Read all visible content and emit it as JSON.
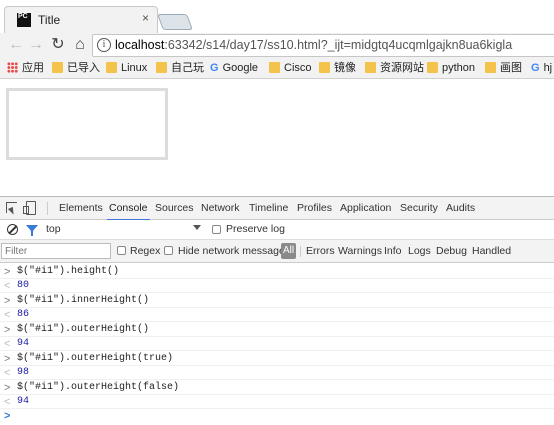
{
  "tab": {
    "favicon_text": "PC",
    "title": "Title",
    "close": "×"
  },
  "toolbar": {
    "back": "←",
    "forward": "→",
    "reload": "↻",
    "home": "⌂",
    "info": "i",
    "url_host": "localhost",
    "url_rest": ":63342/s14/day17/ss10.html?_ijt=midgtq4ucqmlgajkn8ua6kigla"
  },
  "bookmarks": [
    {
      "icon": "apps-icon",
      "label": "应用"
    },
    {
      "icon": "folder-icon",
      "label": "已导入"
    },
    {
      "icon": "folder-icon",
      "label": "Linux"
    },
    {
      "icon": "folder-icon",
      "label": "自己玩"
    },
    {
      "icon": "google-icon",
      "label": "Google"
    },
    {
      "icon": "folder-icon",
      "label": "Cisco"
    },
    {
      "icon": "folder-icon",
      "label": "镜像"
    },
    {
      "icon": "folder-icon",
      "label": "资源网站"
    },
    {
      "icon": "folder-icon",
      "label": "python"
    },
    {
      "icon": "folder-icon",
      "label": "画图"
    },
    {
      "icon": "google-icon",
      "label": "hj"
    }
  ],
  "devtools": {
    "tabs": [
      "Elements",
      "Console",
      "Sources",
      "Network",
      "Timeline",
      "Profiles",
      "Application",
      "Security",
      "Audits"
    ],
    "active_tab": "Console",
    "context": "top",
    "preserve_log": "Preserve log",
    "filter_placeholder": "Filter",
    "regex": "Regex",
    "hide_network": "Hide network messages",
    "levels": [
      "All",
      "Errors",
      "Warnings",
      "Info",
      "Logs",
      "Debug",
      "Handled"
    ]
  },
  "console": [
    {
      "kind": "input",
      "prompt": ">",
      "text": "$(\"#i1\").height()"
    },
    {
      "kind": "result",
      "prompt": "<",
      "text": "80"
    },
    {
      "kind": "input",
      "prompt": ">",
      "text": "$(\"#i1\").innerHeight()"
    },
    {
      "kind": "result",
      "prompt": "<",
      "text": "86"
    },
    {
      "kind": "input",
      "prompt": ">",
      "text": "$(\"#i1\").outerHeight()"
    },
    {
      "kind": "result",
      "prompt": "<",
      "text": "94"
    },
    {
      "kind": "input",
      "prompt": ">",
      "text": "$(\"#i1\").outerHeight(true)"
    },
    {
      "kind": "result",
      "prompt": "<",
      "text": "98"
    },
    {
      "kind": "input",
      "prompt": ">",
      "text": "$(\"#i1\").outerHeight(false)"
    },
    {
      "kind": "result",
      "prompt": "<",
      "text": "94"
    }
  ],
  "console_prompt": ">"
}
